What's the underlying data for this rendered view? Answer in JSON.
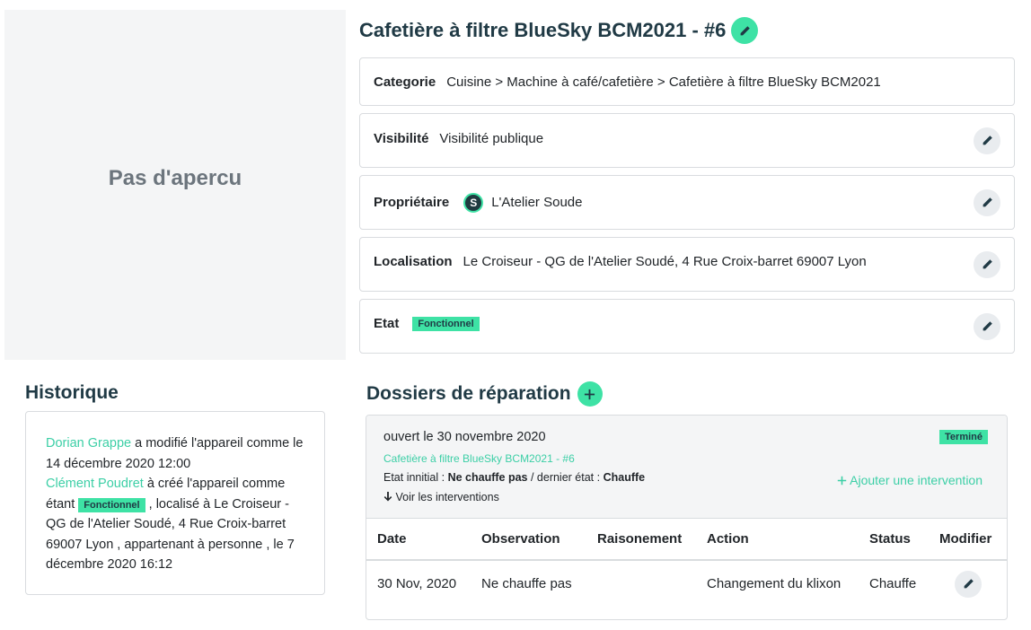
{
  "preview": {
    "text": "Pas d'apercu"
  },
  "device": {
    "title": "Cafetière à filtre BlueSky BCM2021 - #6"
  },
  "info": {
    "categorie": {
      "label": "Categorie",
      "path": "Cuisine > Machine à café/cafetière > ",
      "link": "Cafetière à filtre BlueSky BCM2021"
    },
    "visibilite": {
      "label": "Visibilité",
      "value": "Visibilité publique"
    },
    "proprietaire": {
      "label": "Propriétaire",
      "value": "L'Atelier Soude"
    },
    "localisation": {
      "label": "Localisation",
      "value": "Le Croiseur - QG de l'Atelier Soudé, 4 Rue Croix-barret 69007 Lyon"
    },
    "etat": {
      "label": "Etat",
      "badge": "Fonctionnel"
    }
  },
  "historique": {
    "title": "Historique",
    "entry1": {
      "user": "Dorian Grappe",
      "text": " a modifié l'appareil comme le 14 décembre 2020 12:00"
    },
    "entry2": {
      "user": "Clément Poudret",
      "text_a": " à créé l'appareil comme étant ",
      "badge": "Fonctionnel",
      "text_b": " , localisé à Le Croiseur - QG de l'Atelier Soudé, 4 Rue Croix-barret 69007 Lyon , appartenant à personne , le 7 décembre 2020 16:12"
    }
  },
  "dossiers": {
    "title": "Dossiers de réparation",
    "item": {
      "opened": "ouvert le 30 novembre 2020",
      "status_badge": "Terminé",
      "device_link": "Cafetière à filtre BlueSky BCM2021 - #6",
      "etat_initial_label": "Etat innitial : ",
      "etat_initial": "Ne chauffe pas",
      "dernier_label": " / dernier état : ",
      "dernier": "Chauffe",
      "voir": "Voir les interventions",
      "add": "Ajouter une intervention",
      "columns": [
        "Date",
        "Observation",
        "Raisonement",
        "Action",
        "Status",
        "Modifier"
      ],
      "rows": [
        {
          "date": "30 Nov, 2020",
          "observation": "Ne chauffe pas",
          "raisonement": "",
          "action": "Changement du klixon",
          "status": "Chauffe"
        }
      ]
    }
  },
  "icons": {
    "edit": "pencil-icon",
    "add": "plus-icon",
    "owner": "atelier-soude-logo-icon",
    "arrow": "arrow-down-icon"
  },
  "colors": {
    "accent": "#3ee2a5",
    "link": "#3ccfa6",
    "heading": "#203a45"
  }
}
